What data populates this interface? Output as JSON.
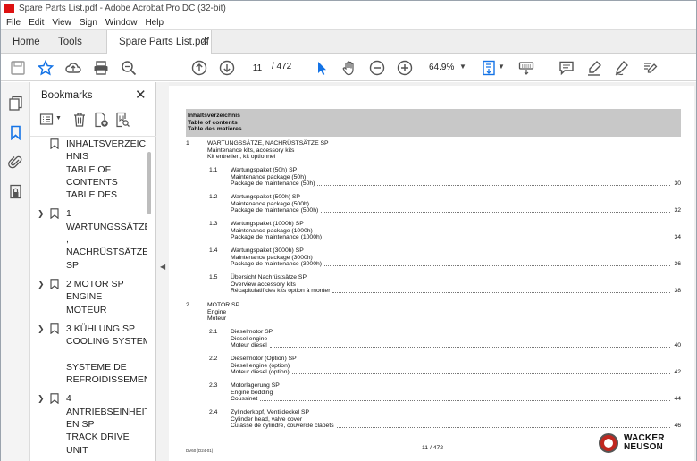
{
  "window": {
    "title": "Spare Parts List.pdf - Adobe Acrobat Pro DC (32-bit)"
  },
  "menu": [
    "File",
    "Edit",
    "View",
    "Sign",
    "Window",
    "Help"
  ],
  "tabs": {
    "home": "Home",
    "tools": "Tools",
    "document": "Spare Parts List.pdf",
    "close_glyph": "✕"
  },
  "toolbar": {
    "page_current": "11",
    "page_total": "/ 472",
    "zoom": "64.9%"
  },
  "bookmarks": {
    "title": "Bookmarks",
    "close_glyph": "✕",
    "items": [
      {
        "expandable": false,
        "lines": [
          "INHALTSVERZEIC",
          "HNIS",
          "TABLE OF",
          "CONTENTS",
          "TABLE DES"
        ]
      },
      {
        "expandable": true,
        "lines": [
          "1",
          "WARTUNGSSÄTZE",
          ",",
          "NACHRÜSTSÄTZE",
          "SP"
        ]
      },
      {
        "expandable": true,
        "lines": [
          "2 MOTOR SP",
          "ENGINE",
          "MOTEUR"
        ]
      },
      {
        "expandable": true,
        "lines": [
          "3 KÜHLUNG SP",
          "COOLING SYSTEM",
          "",
          "SYSTEME DE",
          "REFROIDISSEMEN"
        ]
      },
      {
        "expandable": true,
        "lines": [
          "4",
          "ANTRIEBSEINHEIT",
          "EN SP",
          "TRACK DRIVE",
          "UNIT"
        ]
      }
    ]
  },
  "document": {
    "toc_header": [
      "Inhaltsverzeichnis",
      "Table of contents",
      "Table des matières"
    ],
    "sections": [
      {
        "num": "1",
        "lines": [
          "WARTUNGSSÄTZE, NACHRÜSTSÄTZE SP",
          "Maintenance kits, accessory kits",
          "Kit entretien, kit optionnel"
        ]
      },
      {
        "num": "2",
        "lines": [
          "MOTOR SP",
          "Engine",
          "Moteur"
        ]
      }
    ],
    "subsections": [
      {
        "num": "1.1",
        "lines": [
          "Wartungspaket (50h) SP",
          "Maintenance package (50h)",
          "Package de maintenance (50h)"
        ],
        "page": "30"
      },
      {
        "num": "1.2",
        "lines": [
          "Wartungspaket (500h) SP",
          "Maintenance package (500h)",
          "Package de maintenance (500h)"
        ],
        "page": "32"
      },
      {
        "num": "1.3",
        "lines": [
          "Wartungspaket (1000h) SP",
          "Maintenance package (1000h)",
          "Package de maintenance (1000h)"
        ],
        "page": "34"
      },
      {
        "num": "1.4",
        "lines": [
          "Wartungspaket (3000h) SP",
          "Maintenance package (3000h)",
          "Package de maintenance (3000h)"
        ],
        "page": "36"
      },
      {
        "num": "1.5",
        "lines": [
          "Übersicht Nachrüstsätze SP",
          "Overview accessory kits",
          "Récapitulatif des kits option à monter"
        ],
        "page": "38"
      },
      {
        "num": "2.1",
        "lines": [
          "Dieselmotor SP",
          "Diesel engine",
          "Moteur diesel"
        ],
        "page": "40"
      },
      {
        "num": "2.2",
        "lines": [
          "Dieselmotor (Option) SP",
          "Diesel engine (option)",
          "Moteur diesel (option)"
        ],
        "page": "42"
      },
      {
        "num": "2.3",
        "lines": [
          "Motorlagerung SP",
          "Engine bedding",
          "Coussinet"
        ],
        "page": "44"
      },
      {
        "num": "2.4",
        "lines": [
          "Zylinderkopf, Ventildeckel SP",
          "Cylinder head, valve cover",
          "Culasse de cylindre, couvercle clapets"
        ],
        "page": "46"
      }
    ],
    "footer_code": "DV60 (D24-01)",
    "footer_page": "11 / 472",
    "logo_text": [
      "WACKER",
      "NEUSON"
    ]
  },
  "colors": {
    "accent": "#1473e6",
    "toc_header_bg": "#c8c8c8",
    "logo_red": "#c0271f"
  }
}
